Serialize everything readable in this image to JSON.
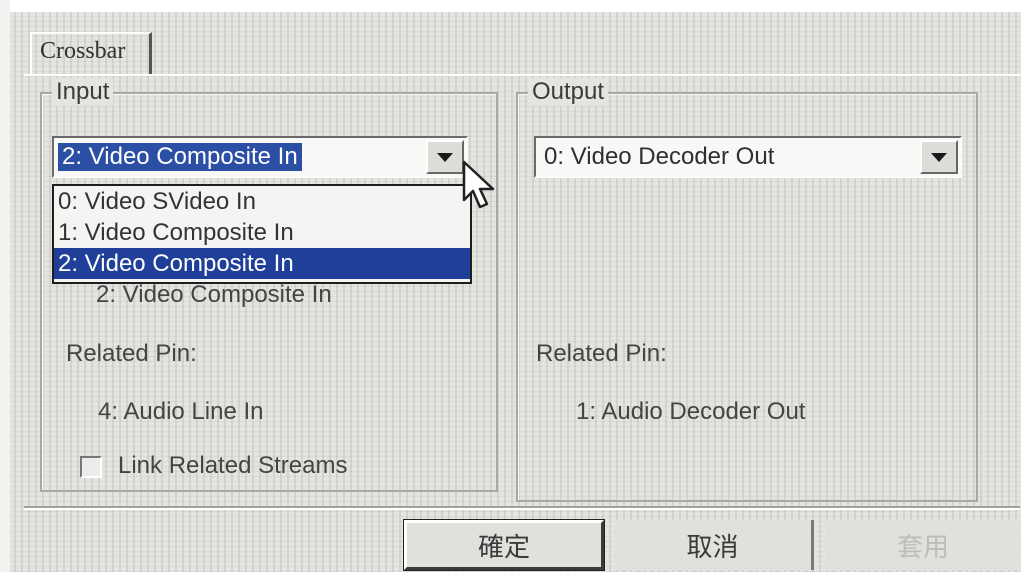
{
  "tab": {
    "label": "Crossbar"
  },
  "input": {
    "legend": "Input",
    "selected": "2: Video Composite In",
    "options": [
      "0: Video SVideo In",
      "1: Video Composite In",
      "2: Video Composite In"
    ],
    "selected_index": 2,
    "current_label": "2: Video Composite In",
    "related_pin_label": "Related Pin:",
    "related_pin_value": "4: Audio Line In",
    "link_label": "Link Related Streams",
    "link_checked": false
  },
  "output": {
    "legend": "Output",
    "selected": "0: Video Decoder Out",
    "related_pin_label": "Related Pin:",
    "related_pin_value": "1: Audio Decoder Out"
  },
  "buttons": {
    "ok": "確定",
    "cancel": "取消",
    "apply": "套用"
  },
  "colors": {
    "selection": "#1f3f99",
    "face": "#e4e4e1"
  },
  "icons": {
    "dropdown": "chevron-down-icon",
    "cursor": "mouse-pointer-icon"
  }
}
